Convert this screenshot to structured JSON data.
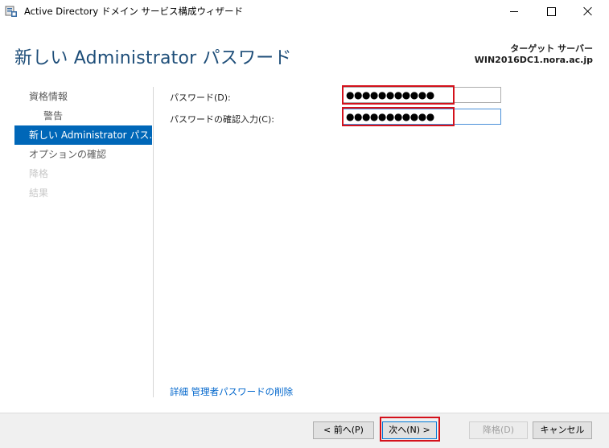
{
  "window": {
    "title": "Active Directory ドメイン サービス構成ウィザード",
    "icon": "ad-wizard-icon"
  },
  "header": {
    "page_title": "新しい Administrator パスワード",
    "target_server_label": "ターゲット サーバー",
    "target_server_value": "WIN2016DC1.nora.ac.jp"
  },
  "nav": {
    "items": [
      {
        "label": "資格情報",
        "state": "normal"
      },
      {
        "label": "警告",
        "state": "normal",
        "sub": true
      },
      {
        "label": "新しい Administrator パス...",
        "state": "active"
      },
      {
        "label": "オプションの確認",
        "state": "normal"
      },
      {
        "label": "降格",
        "state": "disabled"
      },
      {
        "label": "結果",
        "state": "disabled"
      }
    ]
  },
  "form": {
    "password_label": "パスワード(D):",
    "password_mask": "●●●●●●●●●●●",
    "confirm_label": "パスワードの確認入力(C):",
    "confirm_mask": "●●●●●●●●●●●"
  },
  "details_link": "詳細 管理者パスワードの削除",
  "buttons": {
    "back": "< 前へ(P)",
    "next": "次へ(N) >",
    "demote": "降格(D)",
    "cancel": "キャンセル"
  },
  "colors": {
    "accent": "#0067b8",
    "title": "#1e4e79",
    "highlight": "#d4111b",
    "link": "#0066cc"
  }
}
